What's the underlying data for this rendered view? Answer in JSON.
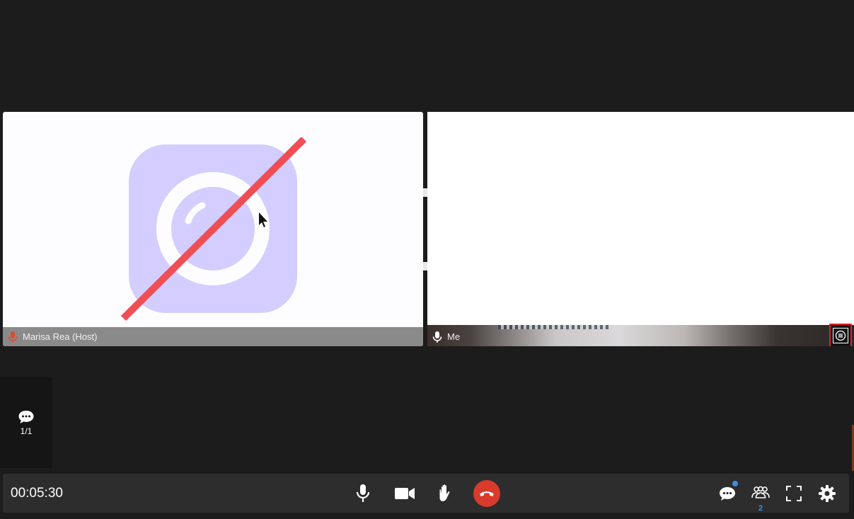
{
  "meeting": {
    "timer": "00:05:30"
  },
  "tiles": {
    "host": {
      "name": "Marisa Rea (Host)",
      "camera_state": "camera-off",
      "mic_state": "muted"
    },
    "me": {
      "name": "Me",
      "mic_state": "on"
    }
  },
  "side_chat": {
    "count": "1/1"
  },
  "toolbar": {
    "participants_count": "2"
  },
  "colors": {
    "background": "#1c1c1c",
    "toolbar": "#2d2d2d",
    "hangup": "#d93a2b",
    "camoff_tile": "#d3ceff",
    "camoff_slash": "#f04e55",
    "accent_blue": "#3b8fe0",
    "highlight": "#e0202a"
  }
}
